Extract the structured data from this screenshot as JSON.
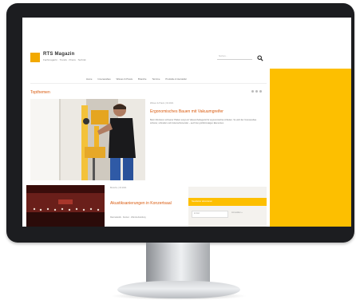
{
  "site": {
    "brand": "RTS Magazin",
    "tagline": "Fachmagazin · Trends · Praxis · Technik",
    "search": {
      "placeholder": "Suchen..."
    },
    "nav": [
      "Home",
      "Innenausbau",
      "Wissen & Praxis",
      "Branche",
      "Termine",
      "Produkte & Hersteller"
    ],
    "section_title": "Topthemen",
    "hero": {
      "meta": "Wissen & Praxis | 04.2021",
      "title": "Ergonomisches Bauen mit Vakuumgreifer",
      "text": "Beim Montieren schwerer Platten sorgt ein Vakuumhebegerät für ergonomisches Arbeiten. So wird der Innenausbau sicherer, schneller und rückenschonender – auch bei großformatigen Elementen."
    },
    "card": {
      "meta": "Branche | 04.2021",
      "title": "Akustiksanierungen in Konzertsaal",
      "text": "Raumakustik · Decken · Wandverkleidung"
    },
    "widget": {
      "bar_label": "Newsletter abonnieren",
      "input_placeholder": "E-Mail",
      "link": "Anmelden »"
    }
  },
  "colors": {
    "accent": "#d95a0e",
    "brand_yellow": "#fdbf00",
    "bezel": "#1c1d20"
  }
}
